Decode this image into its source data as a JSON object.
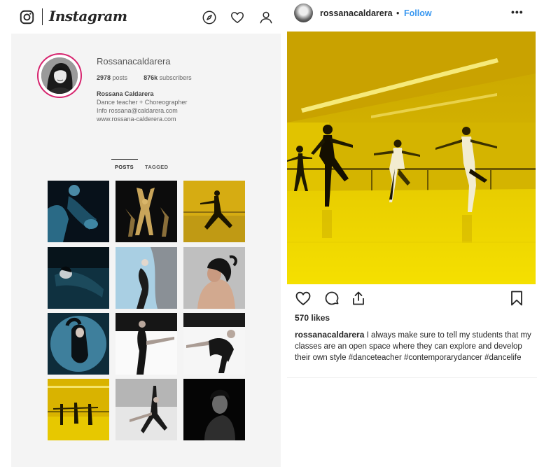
{
  "app": {
    "name": "Instagram"
  },
  "profile": {
    "username": "Rossanacaldarera",
    "posts_count": "2978",
    "posts_label": "posts",
    "subscribers_count": "876k",
    "subscribers_label": "subscribers",
    "full_name": "Rossana Caldarera",
    "bio_line1": "Dance teacher + Choreographer",
    "bio_line2": "Info rossana@caldarera.com",
    "website": "www.rossana-calderera.com",
    "tabs": [
      {
        "label": "POSTS",
        "active": true
      },
      {
        "label": "TAGGED",
        "active": false
      }
    ]
  },
  "post": {
    "username": "rossanacaldarera",
    "separator": "•",
    "follow_label": "Follow",
    "more_label": "•••",
    "likes": "570 likes",
    "caption_user": "rossanacaldarera",
    "caption_text": "I always make sure to tell my students that my classes are an open space where they can explore and develop their own style #danceteacher #contemporarydancer #dancelife"
  },
  "colors": {
    "accent_blue": "#3897f0",
    "story_ring": "#d6246e",
    "text": "#262626",
    "profile_bg": "#f4f4f4"
  },
  "icons": {
    "logo": "instagram-logo-icon",
    "explore": "compass-icon",
    "activity": "heart-icon",
    "profile": "user-icon",
    "like": "heart-icon",
    "comment": "comment-icon",
    "share": "share-icon",
    "save": "bookmark-icon"
  }
}
